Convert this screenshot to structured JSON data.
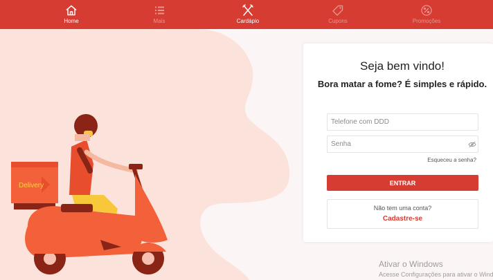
{
  "nav": {
    "items": [
      {
        "label": "Home",
        "icon": "home-icon",
        "active": true
      },
      {
        "label": "Mais",
        "icon": "list-icon",
        "active": false
      },
      {
        "label": "Cardápio",
        "icon": "utensils-icon",
        "active": true
      },
      {
        "label": "Cupons",
        "icon": "tag-icon",
        "active": false
      },
      {
        "label": "Promoções",
        "icon": "percent-icon",
        "active": false
      }
    ]
  },
  "illustration": {
    "box_text": "Delivery"
  },
  "login": {
    "title": "Seja bem vindo!",
    "subtitle": "Bora matar a fome? É simples e rápido.",
    "phone_placeholder": "Telefone com DDD",
    "password_placeholder": "Senha",
    "forgot": "Esqueceu a senha?",
    "submit": "ENTRAR",
    "no_account": "Não tem uma conta?",
    "signup": "Cadastre-se"
  },
  "watermark": {
    "title": "Ativar o Windows",
    "subtitle": "Acesse Configurações para ativar o Windows."
  },
  "colors": {
    "primary": "#d63c31",
    "blob": "#fbe3dc",
    "background": "#fbf6f5"
  }
}
